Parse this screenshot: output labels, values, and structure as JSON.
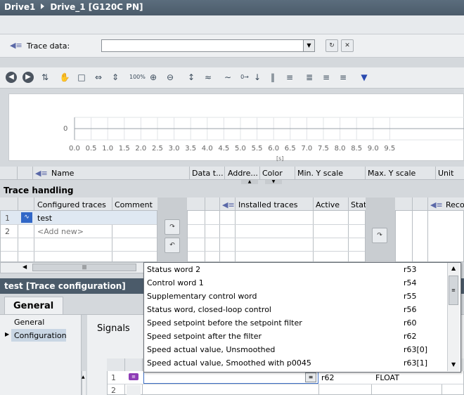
{
  "titlebar": {
    "project": "Drive1",
    "device": "Drive_1 [G120C PN]"
  },
  "trace": {
    "label": "Trace data:",
    "value": ""
  },
  "chart_data": {
    "type": "line",
    "x_ticks": [
      "0.0",
      "0.5",
      "1.0",
      "1.5",
      "2.0",
      "2.5",
      "3.0",
      "3.5",
      "4.0",
      "4.5",
      "5.0",
      "5.5",
      "6.0",
      "6.5",
      "7.0",
      "7.5",
      "8.0",
      "8.5",
      "9.0",
      "9.5"
    ],
    "y_ticks": [
      "0"
    ],
    "xlabel": "[s]",
    "series": []
  },
  "signal_columns": {
    "name": "Name",
    "data_type": "Data t...",
    "address": "Addre...",
    "color": "Color",
    "min_y": "Min. Y scale",
    "max_y": "Max. Y scale",
    "unit": "Unit"
  },
  "trace_handling": {
    "title": "Trace handling",
    "configured_header": "Configured traces",
    "comment_header": "Comment",
    "rows": [
      {
        "num": "1",
        "name": "test"
      },
      {
        "num": "2",
        "name": "<Add new>"
      }
    ],
    "installed_header": "Installed traces",
    "active_header": "Active",
    "status_header": "Stat",
    "recorded_header": "Reco"
  },
  "dropdown": {
    "items": [
      {
        "name": "Status word 2",
        "param": "r53"
      },
      {
        "name": "Control word 1",
        "param": "r54"
      },
      {
        "name": "Supplementary control word",
        "param": "r55"
      },
      {
        "name": "Status word, closed-loop control",
        "param": "r56"
      },
      {
        "name": "Speed setpoint before the setpoint filter",
        "param": "r60"
      },
      {
        "name": "Speed setpoint after the filter",
        "param": "r62"
      },
      {
        "name": "Speed actual value, Unsmoothed",
        "param": "r63[0]"
      },
      {
        "name": "Speed actual value, Smoothed with p0045",
        "param": "r63[1]"
      }
    ]
  },
  "config": {
    "title": "test [Trace configuration]",
    "tab_general": "General",
    "nav_general": "General",
    "nav_configuration": "Configuration",
    "signals_label": "Signals",
    "signal_rows": [
      {
        "num": "1",
        "address": "r62",
        "type": "FLOAT"
      },
      {
        "num": "2",
        "address": "",
        "type": ""
      }
    ]
  }
}
